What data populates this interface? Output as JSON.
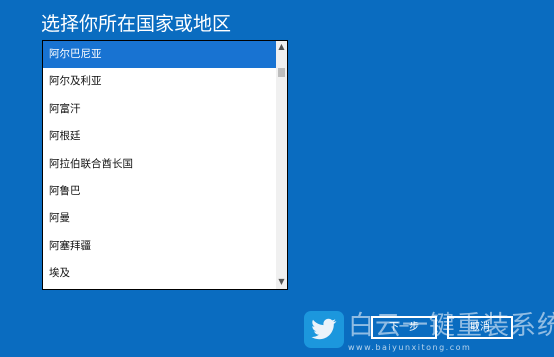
{
  "title": "选择你所在国家或地区",
  "country_list": {
    "items": [
      "阿尔巴尼亚",
      "阿尔及利亚",
      "阿富汗",
      "阿根廷",
      "阿拉伯联合酋长国",
      "阿鲁巴",
      "阿曼",
      "阿塞拜疆",
      "埃及"
    ],
    "selected_index": 0
  },
  "buttons": {
    "next": "下一步",
    "cancel": "取消"
  },
  "watermark": {
    "text": "白云一键重装系统",
    "url": "www.baiyunxitong.com"
  },
  "colors": {
    "background": "#0a6cc0",
    "selected": "#1873d2",
    "logo": "#1e9be0"
  }
}
